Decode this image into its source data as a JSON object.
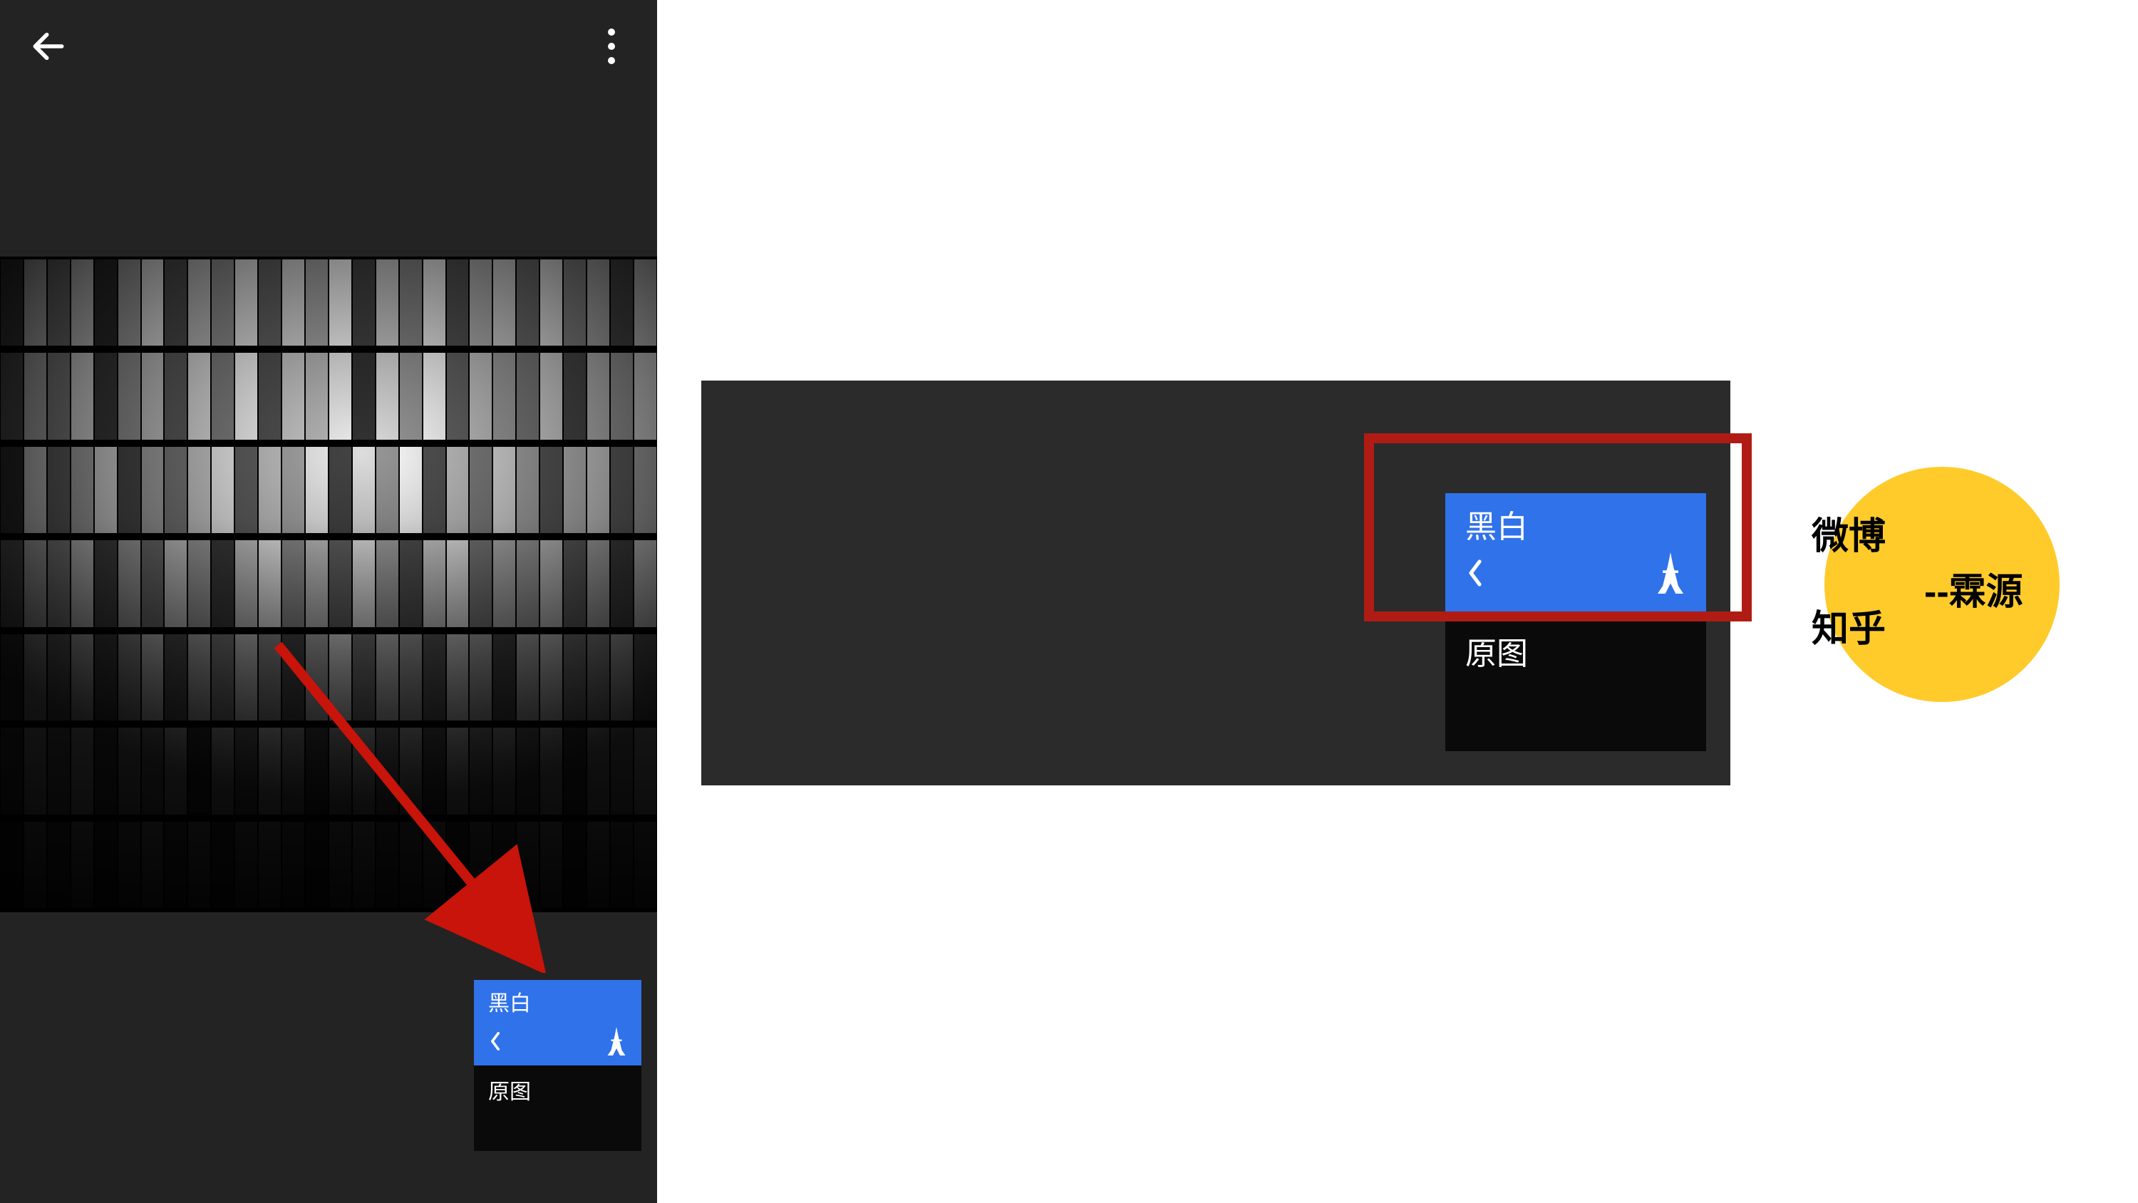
{
  "phone": {
    "filters": {
      "bw": {
        "label": "黑白"
      },
      "original": {
        "label": "原图"
      }
    }
  },
  "zoom": {
    "filters": {
      "bw": {
        "label": "黑白"
      },
      "original": {
        "label": "原图"
      }
    }
  },
  "badge": {
    "tag1": "微博",
    "tag2": "知乎",
    "author": "--霖源"
  }
}
